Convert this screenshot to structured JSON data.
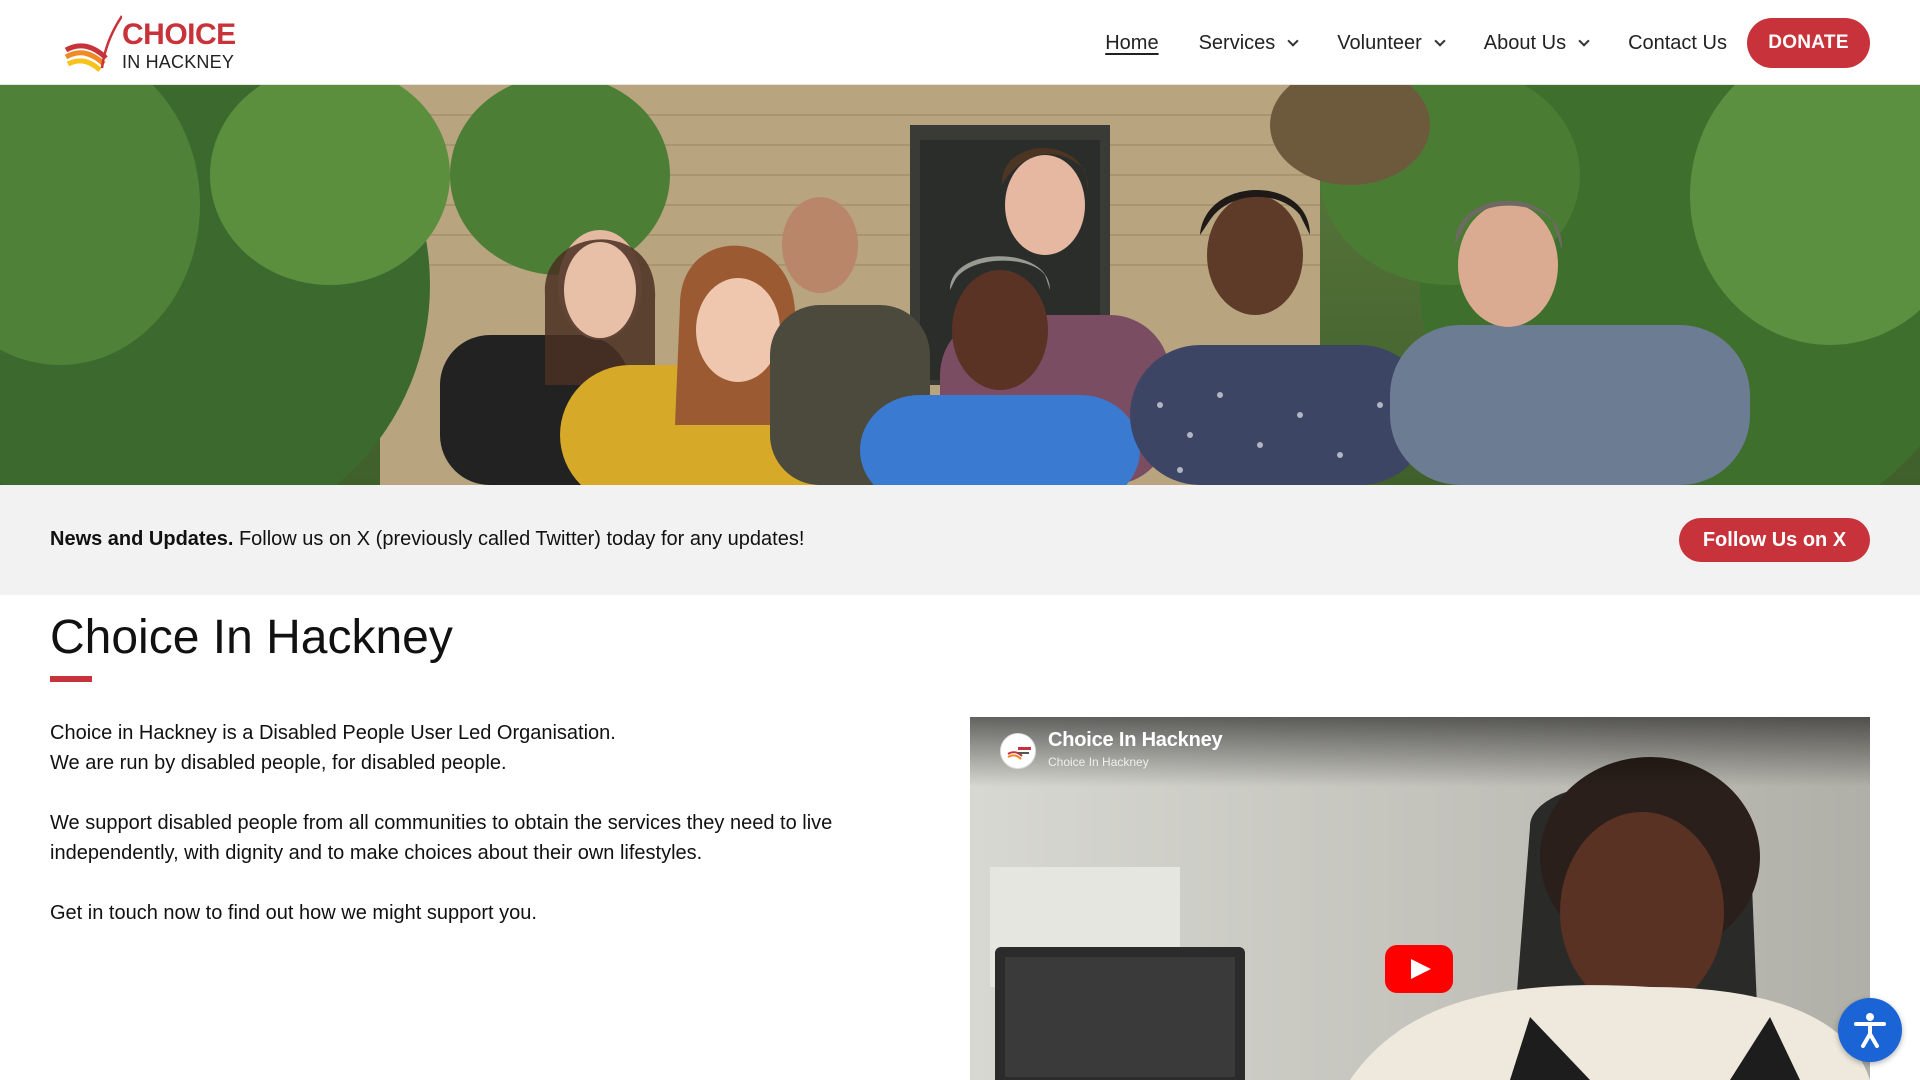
{
  "brand": {
    "logo_line1": "CHOICE",
    "logo_line2": "IN HACKNEY",
    "accent_color": "#c8323a"
  },
  "nav": {
    "items": [
      {
        "label": "Home",
        "active": true
      },
      {
        "label": "Services",
        "dropdown": true
      },
      {
        "label": "Volunteer",
        "dropdown": true
      },
      {
        "label": "About Us",
        "dropdown": true
      },
      {
        "label": "Contact Us"
      }
    ],
    "donate_label": "DONATE"
  },
  "newsbar": {
    "bold": "News and Updates.",
    "text": "Follow us on X (previously called Twitter) today for any updates!",
    "button_label": "Follow Us on X"
  },
  "main": {
    "title": "Choice In Hackney",
    "paragraphs": [
      "Choice in Hackney is a Disabled People User Led Organisation.",
      "We are run by disabled people, for disabled people.",
      "We support disabled people from all communities to obtain the services they need to live independently, with dignity and to make choices about their own lifestyles.",
      "Get in touch now to find out how we might support you."
    ]
  },
  "video": {
    "title": "Choice In Hackney",
    "channel": "Choice In Hackney"
  },
  "icons": {
    "accessibility": "accessibility-icon",
    "play": "play-icon",
    "chevron": "chevron-down-icon"
  }
}
